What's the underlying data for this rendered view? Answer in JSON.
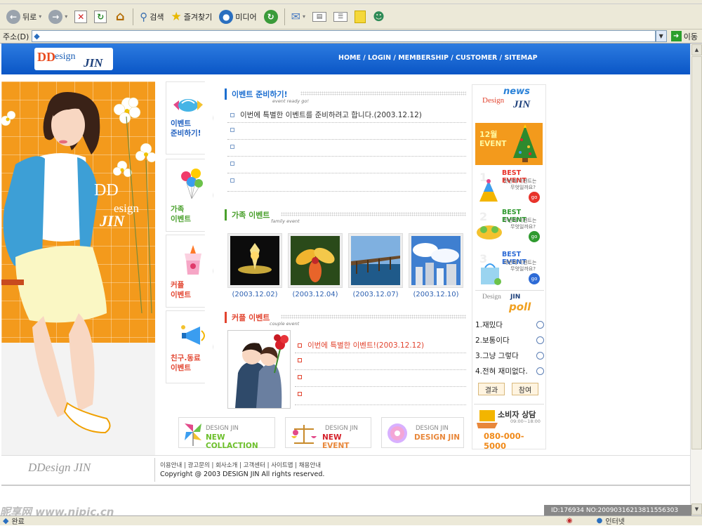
{
  "browser": {
    "toolbar": {
      "back_label": "뒤로",
      "search_label": "검색",
      "favorites_label": "즐겨찾기",
      "media_label": "미디어"
    },
    "address": {
      "label": "주소(D)",
      "value": "",
      "go_label": "이동"
    },
    "status": {
      "left": "완료",
      "zone": "인터넷"
    }
  },
  "site": {
    "logo_text": "DDesign JIN",
    "nav": "HOME / LOGIN / MEMBERSHIP / CUSTOMER / SITEMAP",
    "hero_logo_1": "DD",
    "hero_logo_2": "esign",
    "hero_logo_3": "JIN",
    "sidenav": [
      {
        "label1": "이벤트",
        "label2": "준비하기!"
      },
      {
        "label1": "가족",
        "label2": "이벤트"
      },
      {
        "label1": "커플",
        "label2": "이벤트"
      },
      {
        "label1": "친구.동료",
        "label2": "이벤트"
      }
    ],
    "sections": {
      "prepare": {
        "title": "이벤트 준비하기!",
        "subtitle": "event ready go!",
        "items": [
          "이번에 특별한 이벤트를 준비하려고 합니다.(2003.12.12)",
          "",
          "",
          "",
          ""
        ]
      },
      "family": {
        "title": "가족 이벤트",
        "subtitle": "family event",
        "photos": [
          "(2003.12.02)",
          "(2003.12.04)",
          "(2003.12.07)",
          "(2003.12.10)"
        ]
      },
      "couple": {
        "title": "커플 이벤트",
        "subtitle": "couple event",
        "items": [
          "이번에 특별한 이벤트!(2003.12.12)",
          "",
          "",
          ""
        ]
      }
    },
    "news": {
      "title1": "news",
      "title2": "Design",
      "title3": "JIN",
      "promo_month": "12월",
      "promo_text": "EVENT",
      "best": [
        {
          "num": "1",
          "title": "BEST EVENT",
          "line1": "첫번째 이벤트는",
          "line2": "무엇일까요?",
          "go": "go"
        },
        {
          "num": "2",
          "title": "BEST EVENT",
          "line1": "두번째 이벤트는",
          "line2": "무엇일까요?",
          "go": "go"
        },
        {
          "num": "3",
          "title": "BEST EVENT",
          "line1": "세번째 이벤트는",
          "line2": "무엇일까요?",
          "go": "go"
        }
      ]
    },
    "poll": {
      "title1": "Design",
      "title2": "JIN",
      "title3": "poll",
      "options": [
        "1.재밌다",
        "2.보통이다",
        "3.그냥 그렇다",
        "4.전혀 재미없다."
      ],
      "result_label": "결과",
      "vote_label": "참여"
    },
    "consult": {
      "title": "소비자 상담",
      "hours": "09:00~18:00",
      "phone": "080-000-5000"
    },
    "banners": [
      {
        "top": "DESIGN JIN",
        "bottom": "NEW COLLACTION"
      },
      {
        "top": "DESIGN JIN",
        "bottom1": "NEW",
        "bottom2": "EVENT"
      },
      {
        "top": "DESIGN JIN",
        "bottom": "DESIGN JIN"
      }
    ],
    "footer": {
      "logo": "DDesign JIN",
      "links": "이용안내 | 광고문의 | 회사소개 | 고객센터 | 사이트맵 | 채용안내",
      "copyright": "Copyright @ 2003 DESIGN JIN  All rights reserved."
    }
  },
  "watermark": {
    "text": "昵享网 www.nipic.cn",
    "id": "ID:176934 NO:20090316213811556303"
  },
  "colors": {
    "header_blue": "#0a56c6",
    "hero_orange": "#f39a1c",
    "title_blue": "#1d6fd0",
    "title_green": "#4aa02c",
    "title_red": "#e2442f",
    "best_red": "#e8332a",
    "best_green": "#2f9a2f",
    "best_blue": "#2d6bd6"
  }
}
